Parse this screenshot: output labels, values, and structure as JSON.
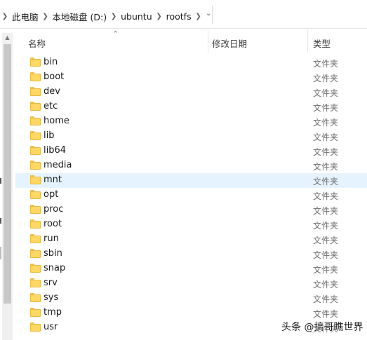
{
  "breadcrumb": [
    "此电脑",
    "本地磁盘 (D:)",
    "ubuntu",
    "rootfs"
  ],
  "columns": {
    "name": "名称",
    "date": "修改日期",
    "type": "类型"
  },
  "files": [
    {
      "name": "bin",
      "type": "文件夹"
    },
    {
      "name": "boot",
      "type": "文件夹"
    },
    {
      "name": "dev",
      "type": "文件夹"
    },
    {
      "name": "etc",
      "type": "文件夹"
    },
    {
      "name": "home",
      "type": "文件夹"
    },
    {
      "name": "lib",
      "type": "文件夹"
    },
    {
      "name": "lib64",
      "type": "文件夹"
    },
    {
      "name": "media",
      "type": "文件夹"
    },
    {
      "name": "mnt",
      "type": "文件夹"
    },
    {
      "name": "opt",
      "type": "文件夹"
    },
    {
      "name": "proc",
      "type": "文件夹"
    },
    {
      "name": "root",
      "type": "文件夹"
    },
    {
      "name": "run",
      "type": "文件夹"
    },
    {
      "name": "sbin",
      "type": "文件夹"
    },
    {
      "name": "snap",
      "type": "文件夹"
    },
    {
      "name": "srv",
      "type": "文件夹"
    },
    {
      "name": "sys",
      "type": "文件夹"
    },
    {
      "name": "tmp",
      "type": "文件夹"
    },
    {
      "name": "usr",
      "type": "文件夹"
    }
  ],
  "hover_row": "mnt",
  "watermark": "头条 @搞哥瞧世界"
}
